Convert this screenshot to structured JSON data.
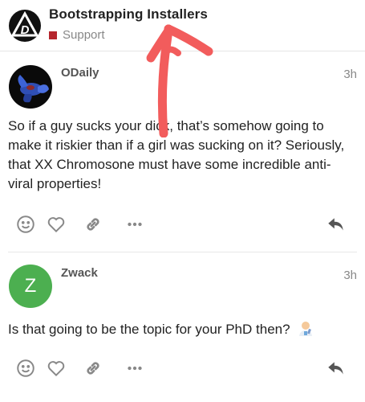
{
  "header": {
    "title": "Bootstrapping Installers",
    "category": "Support",
    "category_color": "#b5262d"
  },
  "posts": [
    {
      "username": "ODaily",
      "time": "3h",
      "avatar": "fish-avatar",
      "body": "So if a guy sucks your dick, that’s somehow going to make it riskier than if a girl was sucking on it? Seriously, that XX Chromosone must have some incredible anti-viral properties!"
    },
    {
      "username": "Zwack",
      "time": "3h",
      "avatar_letter": "Z",
      "avatar_color": "#4caf50",
      "body": "Is that going to be the topic for your PhD then?",
      "emoji": "scientist-emoji"
    }
  ],
  "icons": [
    "smiley-icon",
    "heart-icon",
    "link-icon",
    "more-icon",
    "reply-icon"
  ]
}
